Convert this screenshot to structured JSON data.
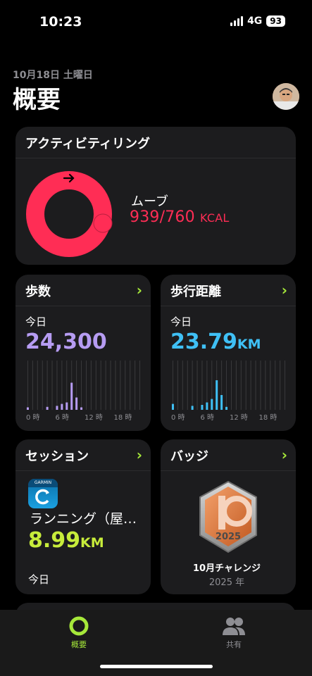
{
  "status": {
    "time": "10:23",
    "network": "4G",
    "battery": "93"
  },
  "header": {
    "date": "10月18日 土曜日",
    "title": "概要"
  },
  "activity": {
    "title": "アクティビティリング",
    "move_label": "ムーブ",
    "move_value": "939/760",
    "move_unit": "KCAL",
    "ring_color": "#ff2d55",
    "move_progress": 1.235
  },
  "steps": {
    "title": "歩数",
    "today_label": "今日",
    "value": "24,300",
    "value_color": "#b69cf2",
    "axis": [
      "0 時",
      "6 時",
      "12 時",
      "18 時"
    ],
    "bars": [
      0.05,
      0,
      0,
      0,
      0.06,
      0,
      0.08,
      0.12,
      0.15,
      0.55,
      0.25,
      0.05,
      0,
      0,
      0,
      0,
      0,
      0,
      0,
      0,
      0,
      0,
      0,
      0
    ]
  },
  "distance": {
    "title": "歩行距離",
    "today_label": "今日",
    "value": "23.79",
    "unit": "KM",
    "value_color": "#3fc0f5",
    "axis": [
      "0 時",
      "6 時",
      "12 時",
      "18 時"
    ],
    "bars": [
      0.12,
      0,
      0,
      0,
      0.08,
      0,
      0.1,
      0.15,
      0.22,
      0.6,
      0.3,
      0.06,
      0,
      0,
      0,
      0,
      0,
      0,
      0,
      0,
      0,
      0,
      0,
      0
    ]
  },
  "session": {
    "title": "セッション",
    "app_icon": "garmin-connect-icon",
    "name": "ランニング（屋…",
    "value": "8.99",
    "unit": "KM",
    "date": "今日"
  },
  "badges": {
    "title": "バッジ",
    "badge_name": "10月チャレンジ",
    "badge_year": "2025 年"
  },
  "tabbar": {
    "summary": "概要",
    "sharing": "共有"
  },
  "colors": {
    "accent": "#a6e83a",
    "card": "#1c1c1e"
  }
}
